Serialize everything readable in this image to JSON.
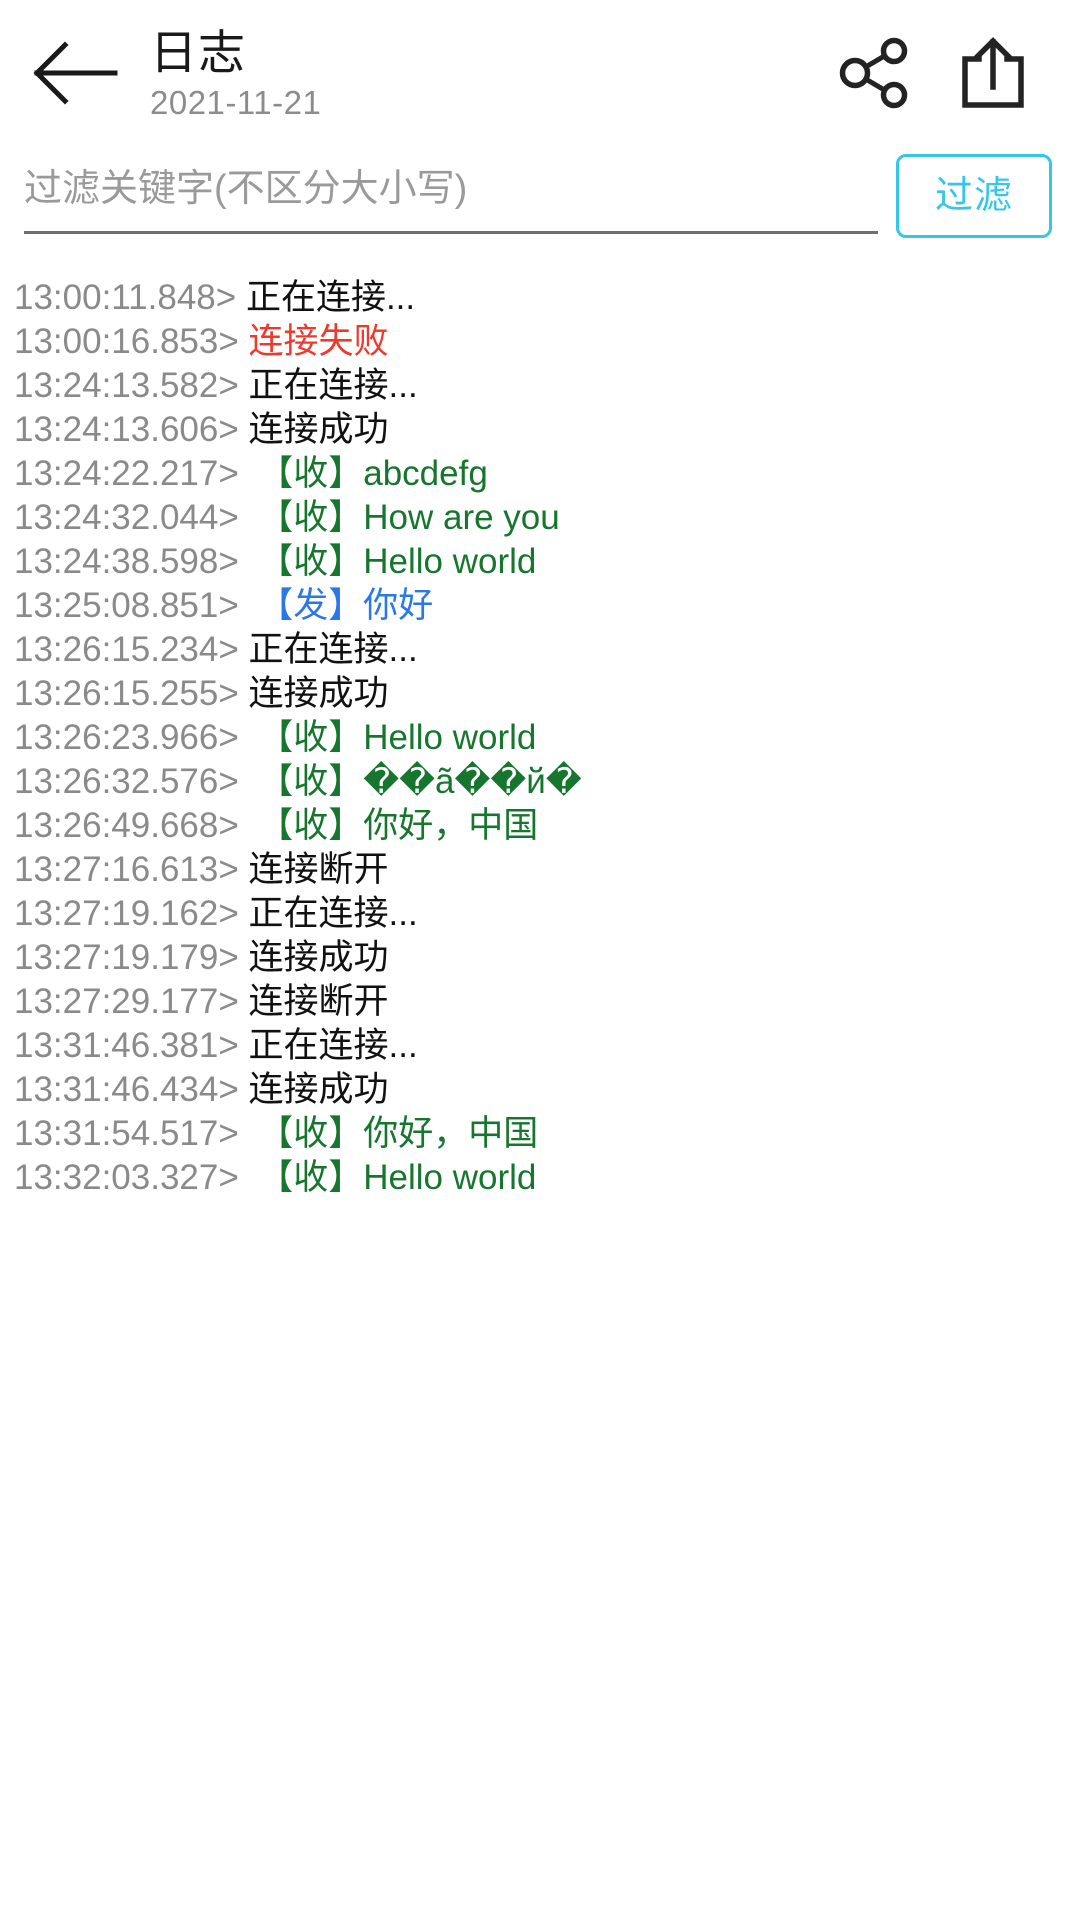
{
  "appbar": {
    "back_icon": "arrow-left-icon",
    "title": "日志",
    "subtitle": "2021-11-21",
    "share_icon": "share-nodes-icon",
    "export_icon": "export-upload-icon"
  },
  "filter": {
    "placeholder": "过滤关键字(不区分大小写)",
    "value": "",
    "button_label": "过滤",
    "accent_color": "#35c6e8"
  },
  "colors": {
    "info": "#111111",
    "error": "#f0392b",
    "recv": "#17762e",
    "send": "#2a78e8",
    "timestamp": "#8a8a8a"
  },
  "log": {
    "entries": [
      {
        "ts": "13:00:11.848> ",
        "msg": "正在连接...",
        "level": "info"
      },
      {
        "ts": "13:00:16.853> ",
        "msg": "连接失败",
        "level": "error"
      },
      {
        "ts": "13:24:13.582> ",
        "msg": "正在连接...",
        "level": "info"
      },
      {
        "ts": "13:24:13.606> ",
        "msg": "连接成功",
        "level": "info"
      },
      {
        "ts": "13:24:22.217> ",
        "msg": " 【收】abcdefg",
        "level": "recv"
      },
      {
        "ts": "13:24:32.044> ",
        "msg": " 【收】How are you",
        "level": "recv"
      },
      {
        "ts": "13:24:38.598> ",
        "msg": " 【收】Hello world",
        "level": "recv"
      },
      {
        "ts": "13:25:08.851> ",
        "msg": " 【发】你好",
        "level": "send"
      },
      {
        "ts": "13:26:15.234> ",
        "msg": "正在连接...",
        "level": "info"
      },
      {
        "ts": "13:26:15.255> ",
        "msg": "连接成功",
        "level": "info"
      },
      {
        "ts": "13:26:23.966> ",
        "msg": " 【收】Hello world",
        "level": "recv"
      },
      {
        "ts": "13:26:32.576> ",
        "msg": " 【收】��ã��й�",
        "level": "recv"
      },
      {
        "ts": "13:26:49.668> ",
        "msg": " 【收】你好，中国",
        "level": "recv"
      },
      {
        "ts": "13:27:16.613> ",
        "msg": "连接断开",
        "level": "info"
      },
      {
        "ts": "13:27:19.162> ",
        "msg": "正在连接...",
        "level": "info"
      },
      {
        "ts": "13:27:19.179> ",
        "msg": "连接成功",
        "level": "info"
      },
      {
        "ts": "13:27:29.177> ",
        "msg": "连接断开",
        "level": "info"
      },
      {
        "ts": "13:31:46.381> ",
        "msg": "正在连接...",
        "level": "info"
      },
      {
        "ts": "13:31:46.434> ",
        "msg": "连接成功",
        "level": "info"
      },
      {
        "ts": "13:31:54.517> ",
        "msg": " 【收】你好，中国",
        "level": "recv"
      },
      {
        "ts": "13:32:03.327> ",
        "msg": " 【收】Hello world",
        "level": "recv"
      }
    ]
  }
}
